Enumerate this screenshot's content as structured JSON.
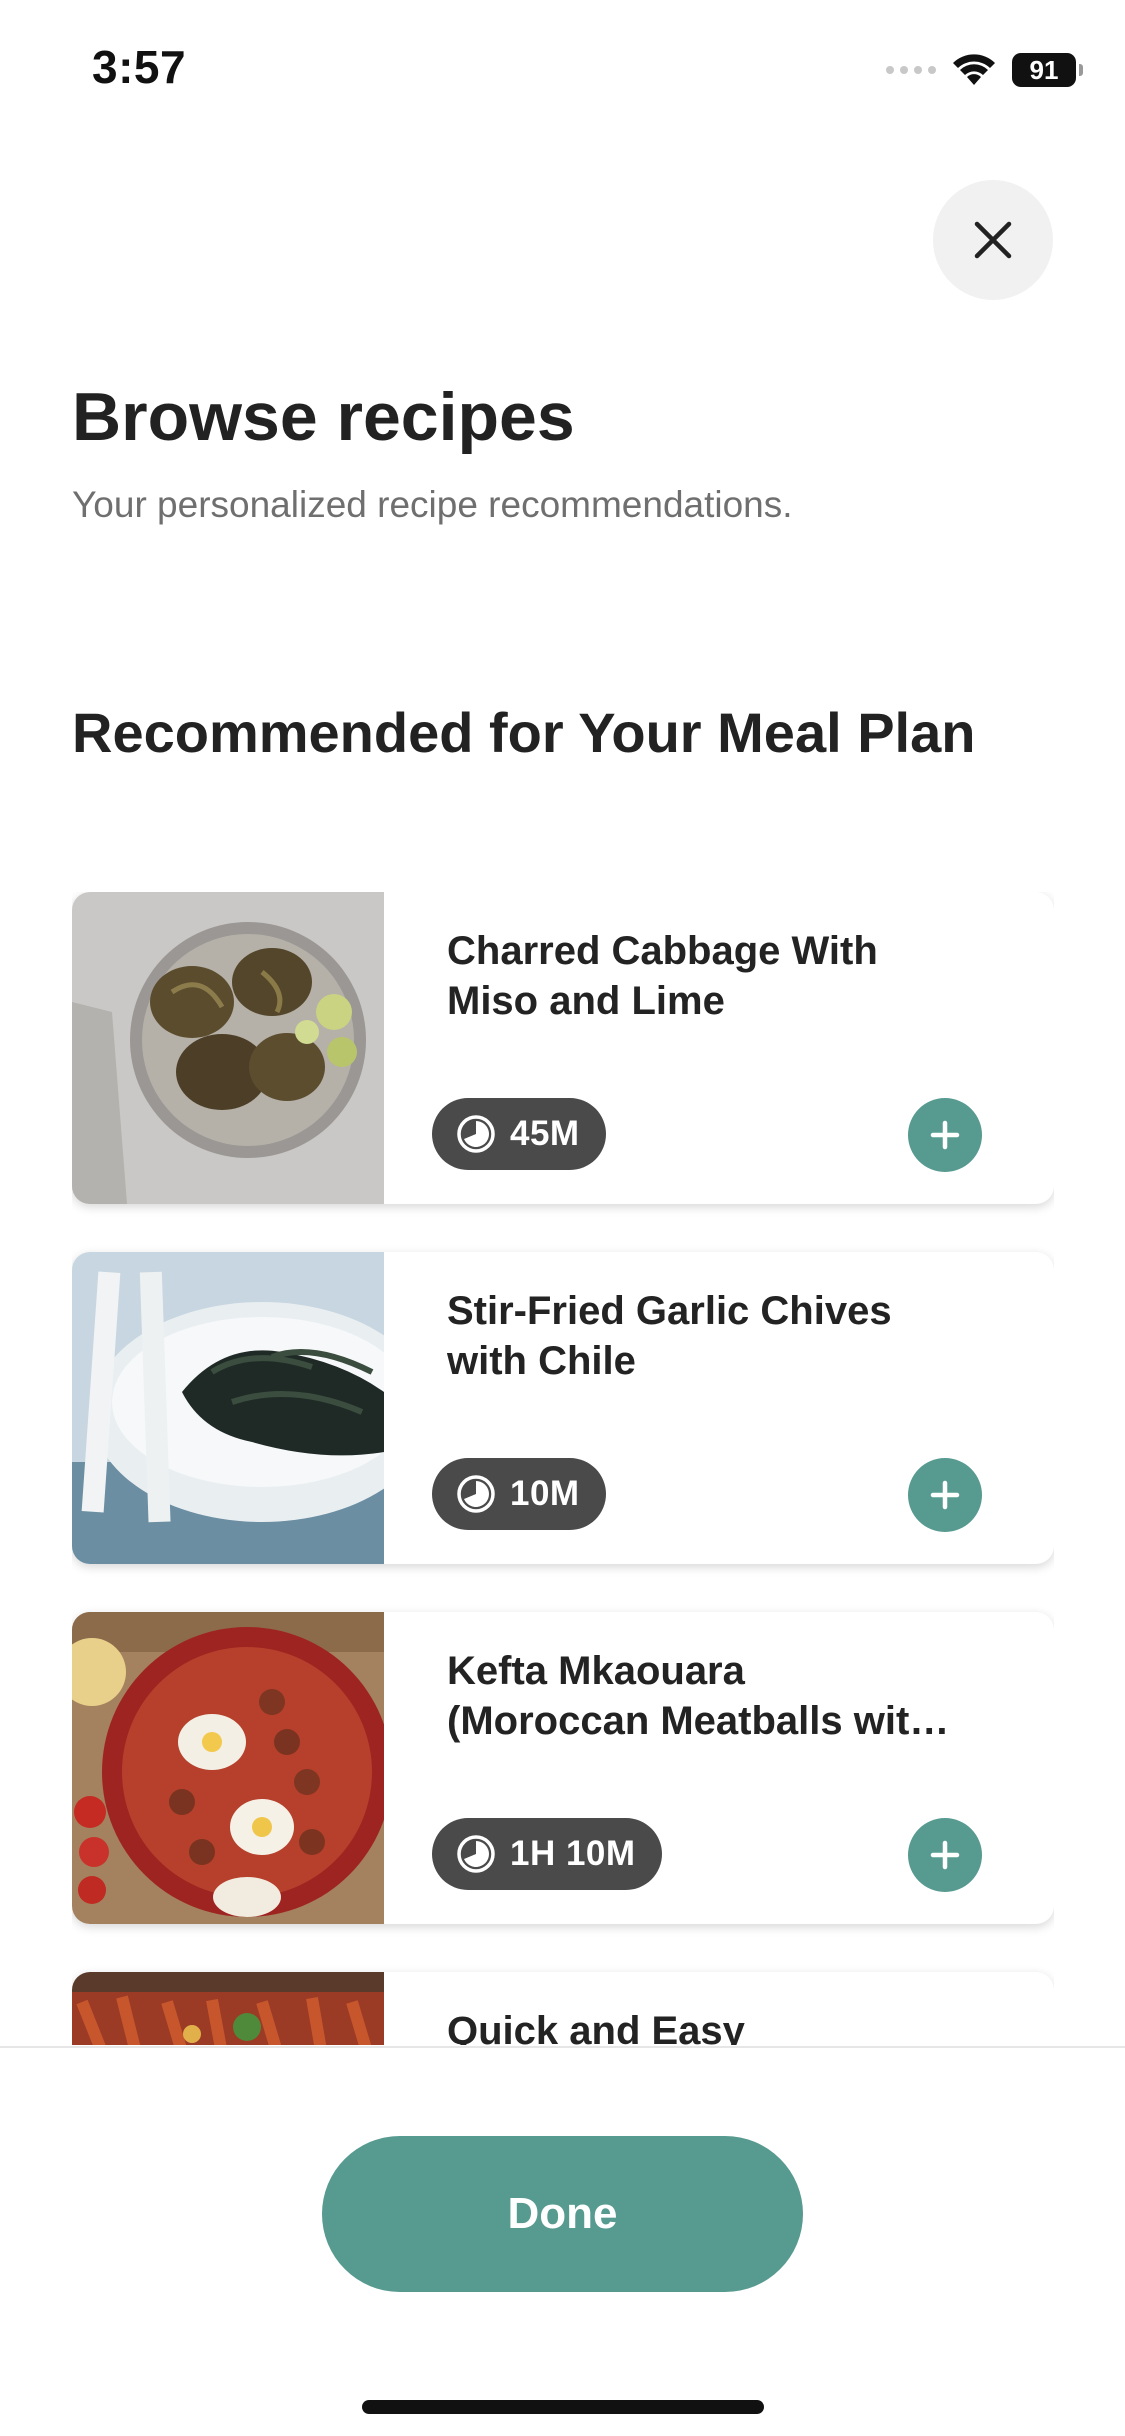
{
  "status_bar": {
    "time": "3:57",
    "battery": "91"
  },
  "header": {
    "title": "Browse recipes",
    "subtitle": "Your personalized recipe recommendations."
  },
  "section": {
    "title": "Recommended for Your Meal Plan"
  },
  "recipes": [
    {
      "title": "Charred Cabbage With\nMiso and Lime",
      "time": "45M"
    },
    {
      "title": "Stir-Fried Garlic Chives\nwith Chile",
      "time": "10M"
    },
    {
      "title": "Kefta Mkaouara\n(Moroccan Meatballs wit…",
      "time": "1H 10M"
    },
    {
      "title": "Quick and Easy",
      "time": ""
    }
  ],
  "footer": {
    "done_label": "Done"
  },
  "colors": {
    "accent": "#569a90",
    "pill": "#4a4a4a"
  },
  "icons": {
    "close": "close-icon",
    "clock": "clock-icon",
    "add": "plus-icon"
  }
}
